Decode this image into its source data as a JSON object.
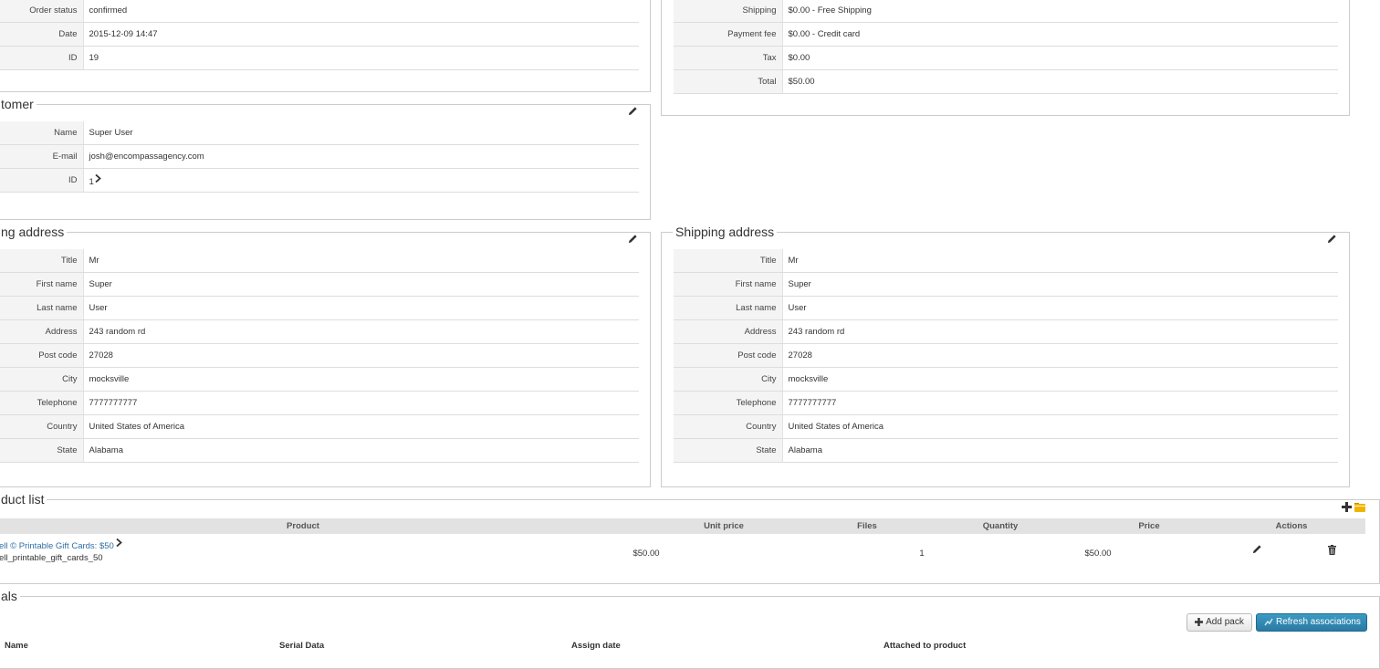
{
  "order": {
    "rows": [
      {
        "label": "Order status",
        "value": "confirmed"
      },
      {
        "label": "Date",
        "value": "2015-12-09 14:47"
      },
      {
        "label": "ID",
        "value": "19"
      }
    ]
  },
  "payment": {
    "rows": [
      {
        "label": "Shipping",
        "value": "$0.00 - Free Shipping"
      },
      {
        "label": "Payment fee",
        "value": "$0.00 - Credit card"
      },
      {
        "label": "Tax",
        "value": "$0.00"
      },
      {
        "label": "Total",
        "value": "$50.00"
      }
    ]
  },
  "customer": {
    "legend": "tomer",
    "rows": [
      {
        "label": "Name",
        "value": "Super User"
      },
      {
        "label": "E-mail",
        "value": "josh@encompassagency.com"
      },
      {
        "label": "ID",
        "value": "1"
      }
    ]
  },
  "billing": {
    "legend": "ng address",
    "rows": [
      {
        "label": "Title",
        "value": "Mr"
      },
      {
        "label": "First name",
        "value": "Super"
      },
      {
        "label": "Last name",
        "value": "User"
      },
      {
        "label": "Address",
        "value": "243 random rd"
      },
      {
        "label": "Post code",
        "value": "27028"
      },
      {
        "label": "City",
        "value": "mocksville"
      },
      {
        "label": "Telephone",
        "value": "7777777777"
      },
      {
        "label": "Country",
        "value": "United States of America"
      },
      {
        "label": "State",
        "value": "Alabama"
      }
    ]
  },
  "shipping": {
    "legend": "Shipping address",
    "rows": [
      {
        "label": "Title",
        "value": "Mr"
      },
      {
        "label": "First name",
        "value": "Super"
      },
      {
        "label": "Last name",
        "value": "User"
      },
      {
        "label": "Address",
        "value": "243 random rd"
      },
      {
        "label": "Post code",
        "value": "27028"
      },
      {
        "label": "City",
        "value": "mocksville"
      },
      {
        "label": "Telephone",
        "value": "7777777777"
      },
      {
        "label": "Country",
        "value": "United States of America"
      },
      {
        "label": "State",
        "value": "Alabama"
      }
    ]
  },
  "products": {
    "legend": "duct list",
    "columns": [
      "Product",
      "Unit price",
      "Files",
      "Quantity",
      "Price",
      "Actions"
    ],
    "row": {
      "name": "ell © Printable Gift Cards: $50",
      "code": "ell_printable_gift_cards_50",
      "unit_price": "$50.00",
      "files": "",
      "quantity": "1",
      "price": "$50.00"
    }
  },
  "serials": {
    "legend": "als",
    "add_pack_label": "Add pack",
    "refresh_label": "Refresh associations",
    "columns": [
      "Name",
      "Serial Data",
      "Assign date",
      "Attached to product"
    ]
  },
  "colors": {
    "link": "#2f6fa6",
    "primary_button": "#2b7aa3",
    "header_bg": "#e2e2e2"
  }
}
